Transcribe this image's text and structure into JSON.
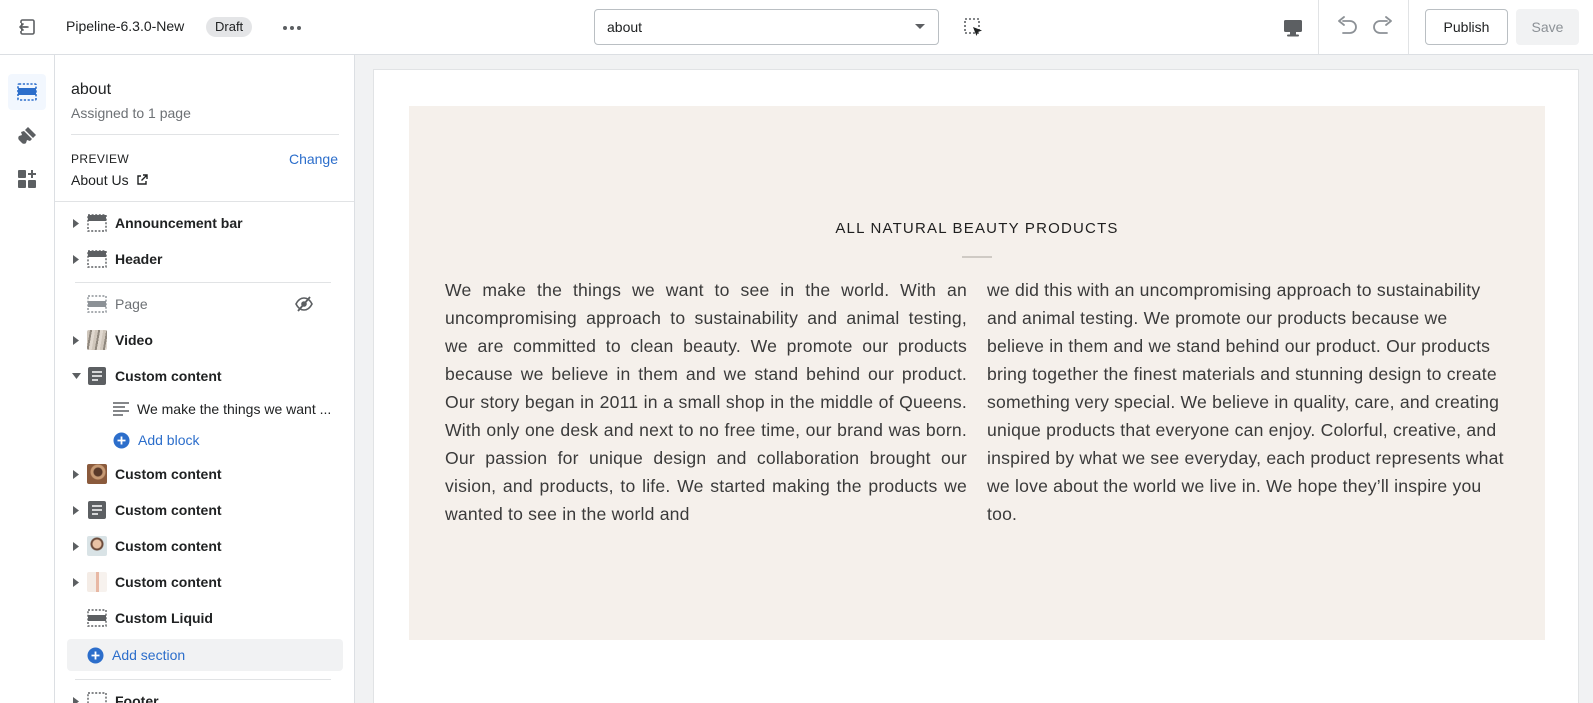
{
  "topbar": {
    "theme_name": "Pipeline-6.3.0-New",
    "badge": "Draft",
    "template_value": "about",
    "publish_label": "Publish",
    "save_label": "Save"
  },
  "sidebar": {
    "template_title": "about",
    "template_subtitle": "Assigned to 1 page",
    "preview_label": "PREVIEW",
    "change_label": "Change",
    "preview_page": "About Us",
    "items": [
      {
        "label": "Announcement bar"
      },
      {
        "label": "Header"
      },
      {
        "label": "Page"
      },
      {
        "label": "Video"
      },
      {
        "label": "Custom content"
      },
      {
        "label": "We make the things we want ..."
      },
      {
        "label": "Add block"
      },
      {
        "label": "Custom content"
      },
      {
        "label": "Custom content"
      },
      {
        "label": "Custom content"
      },
      {
        "label": "Custom content"
      },
      {
        "label": "Custom Liquid"
      },
      {
        "label": "Add section"
      },
      {
        "label": "Footer"
      }
    ]
  },
  "canvas": {
    "heading": "ALL NATURAL BEAUTY PRODUCTS",
    "column_1": "We make the things we want to see in the world. With an uncompromising approach to sustainability and animal testing, we are committed to clean beauty. We promote our products because we believe in them and we stand behind our product. Our story began in 2011 in a small shop in the middle of Queens. With only one desk and next to no free time, our brand was born. Our passion for unique design and collaboration brought our vision, and products, to life. We started making the products we wanted to see in the world and",
    "column_2": "we did this with an uncompromising approach to sustainability and animal testing. We promote our products because we believe in them and we stand behind our product. Our products bring together the finest materials and stunning design to create something very special. We believe in quality, care, and creating unique products that everyone can enjoy. Colorful, creative, and inspired by what we see everyday, each product represents what we love about the world we live in. We hope they’ll inspire you too."
  },
  "colors": {
    "accent": "#2c6ecb",
    "panel_bg": "#f5f0eb"
  },
  "icons": {
    "exit": "exit-icon",
    "more": "more-horizontal-icon",
    "select_arrow": "caret-down-icon",
    "inspector": "inspector-icon",
    "desktop": "desktop-icon",
    "undo": "undo-icon",
    "redo": "redo-icon",
    "rail_sections": "sections-icon",
    "rail_theme": "paintbrush-icon",
    "rail_apps": "apps-icon"
  }
}
